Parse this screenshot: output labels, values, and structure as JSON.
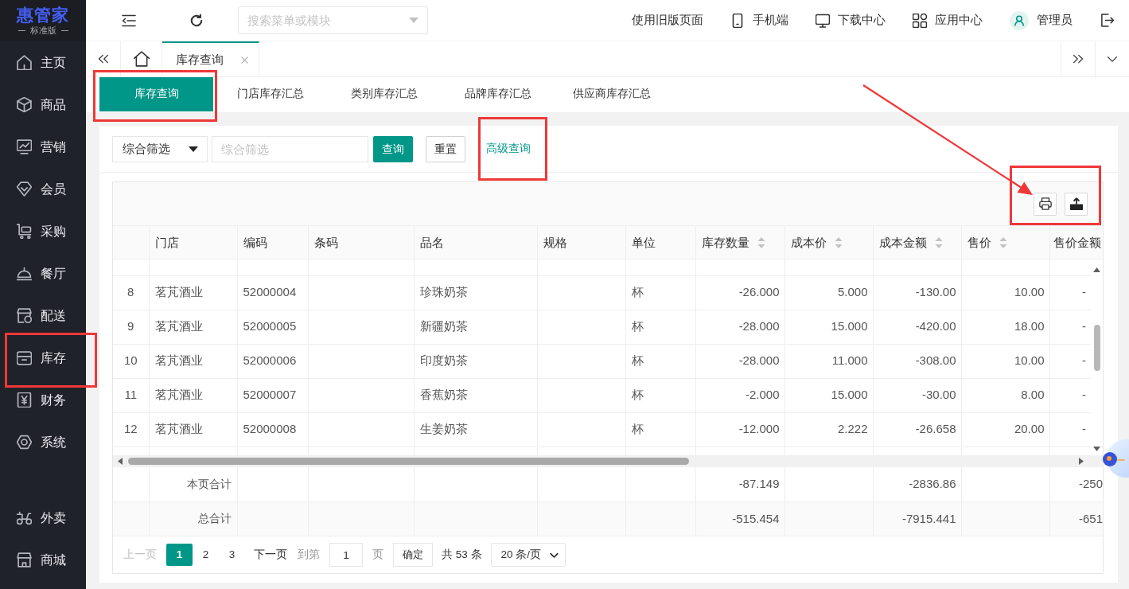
{
  "sidebar": {
    "logo": "惠管家",
    "edition": "标准版",
    "items": [
      {
        "label": "主页",
        "highlighted": false
      },
      {
        "label": "商品",
        "highlighted": false
      },
      {
        "label": "营销",
        "highlighted": false
      },
      {
        "label": "会员",
        "highlighted": false
      },
      {
        "label": "采购",
        "highlighted": false
      },
      {
        "label": "餐厅",
        "highlighted": false
      },
      {
        "label": "配送",
        "highlighted": false
      },
      {
        "label": "库存",
        "highlighted": true
      },
      {
        "label": "财务",
        "highlighted": false
      },
      {
        "label": "系统",
        "highlighted": false
      }
    ],
    "bottom_items": [
      {
        "label": "外卖",
        "highlighted": false
      },
      {
        "label": "商城",
        "highlighted": false
      }
    ]
  },
  "header": {
    "search": {
      "placeholder": "搜索菜单或模块"
    },
    "links": [
      {
        "label": "使用旧版页面"
      },
      {
        "label": "手机端"
      },
      {
        "label": "下载中心"
      },
      {
        "label": "应用中心"
      }
    ],
    "user": {
      "name": "管理员"
    }
  },
  "page_tabs": [
    {
      "label": "库存查询",
      "selected": true
    }
  ],
  "sub_tabs": [
    {
      "label": "库存查询",
      "selected": true,
      "highlighted": true
    },
    {
      "label": "门店库存汇总",
      "selected": false,
      "highlighted": false
    },
    {
      "label": "类别库存汇总",
      "selected": false,
      "highlighted": false
    },
    {
      "label": "品牌库存汇总",
      "selected": false,
      "highlighted": false
    },
    {
      "label": "供应商库存汇总",
      "selected": false,
      "highlighted": false
    }
  ],
  "filter": {
    "field_select": "综合筛选",
    "keyword": {
      "placeholder": "综合筛选"
    },
    "search_button": "查询",
    "reset_button": "重置",
    "advanced_link": {
      "label": "高级查询",
      "highlighted": true
    }
  },
  "table": {
    "toolbar": {
      "highlighted": true,
      "arrow": true
    },
    "columns": [
      {
        "label": "门店",
        "sortable": false
      },
      {
        "label": "编码",
        "sortable": false
      },
      {
        "label": "条码",
        "sortable": false
      },
      {
        "label": "品名",
        "sortable": false
      },
      {
        "label": "规格",
        "sortable": false
      },
      {
        "label": "单位",
        "sortable": false
      },
      {
        "label": "库存数量",
        "sortable": true
      },
      {
        "label": "成本价",
        "sortable": true
      },
      {
        "label": "成本金额",
        "sortable": true
      },
      {
        "label": "售价",
        "sortable": true
      },
      {
        "label": "售价金额",
        "sortable": false
      }
    ],
    "rows": [
      {
        "index": "8",
        "store": "茗芃酒业",
        "code": "52000004",
        "name": "珍珠奶茶",
        "unit": "杯",
        "stock_qty": "-26.000",
        "cost_price": "5.000",
        "cost_amount": "-130.00",
        "sale_price": "10.00",
        "sale_amount": "-"
      },
      {
        "index": "9",
        "store": "茗芃酒业",
        "code": "52000005",
        "name": "新疆奶茶",
        "unit": "杯",
        "stock_qty": "-28.000",
        "cost_price": "15.000",
        "cost_amount": "-420.00",
        "sale_price": "18.00",
        "sale_amount": "-"
      },
      {
        "index": "10",
        "store": "茗芃酒业",
        "code": "52000006",
        "name": "印度奶茶",
        "unit": "杯",
        "stock_qty": "-28.000",
        "cost_price": "11.000",
        "cost_amount": "-308.00",
        "sale_price": "10.00",
        "sale_amount": "-"
      },
      {
        "index": "11",
        "store": "茗芃酒业",
        "code": "52000007",
        "name": "香蕉奶茶",
        "unit": "杯",
        "stock_qty": "-2.000",
        "cost_price": "15.000",
        "cost_amount": "-30.00",
        "sale_price": "8.00",
        "sale_amount": "-"
      },
      {
        "index": "12",
        "store": "茗芃酒业",
        "code": "52000008",
        "name": "生姜奶茶",
        "unit": "杯",
        "stock_qty": "-12.000",
        "cost_price": "2.222",
        "cost_amount": "-26.658",
        "sale_price": "20.00",
        "sale_amount": "-"
      }
    ],
    "summary_rows": [
      {
        "label": "本页合计",
        "stock_qty": "-87.149",
        "cost_amount": "-2836.86",
        "sale_amount": "-250"
      },
      {
        "label": "总合计",
        "stock_qty": "-515.454",
        "cost_amount": "-7915.441",
        "sale_amount": "-651"
      }
    ]
  },
  "pagination": {
    "prev": {
      "label": "上一页",
      "disabled": true
    },
    "pages": [
      {
        "label": "1",
        "selected": true
      },
      {
        "label": "2",
        "selected": false
      },
      {
        "label": "3",
        "selected": false
      }
    ],
    "next": {
      "label": "下一页",
      "disabled": false
    },
    "goto_label": "到第",
    "goto_value": "1",
    "page_unit": "页",
    "confirm_button": "确定",
    "total": "共 53 条",
    "page_size": "20 条/页"
  }
}
